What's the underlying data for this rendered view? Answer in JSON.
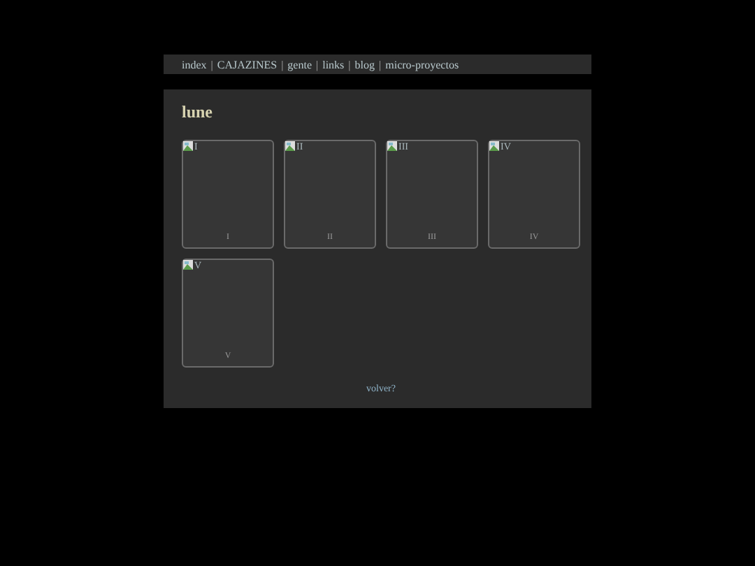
{
  "nav": {
    "links": [
      "index",
      "CAJAZINES",
      "gente",
      "links",
      "blog",
      "micro-proyectos"
    ],
    "separator": "|"
  },
  "title": "lune",
  "cards": [
    {
      "alt": "I",
      "caption": "I"
    },
    {
      "alt": "II",
      "caption": "II"
    },
    {
      "alt": "III",
      "caption": "III"
    },
    {
      "alt": "IV",
      "caption": "IV"
    },
    {
      "alt": "V",
      "caption": "V"
    }
  ],
  "back_link": "volver?"
}
